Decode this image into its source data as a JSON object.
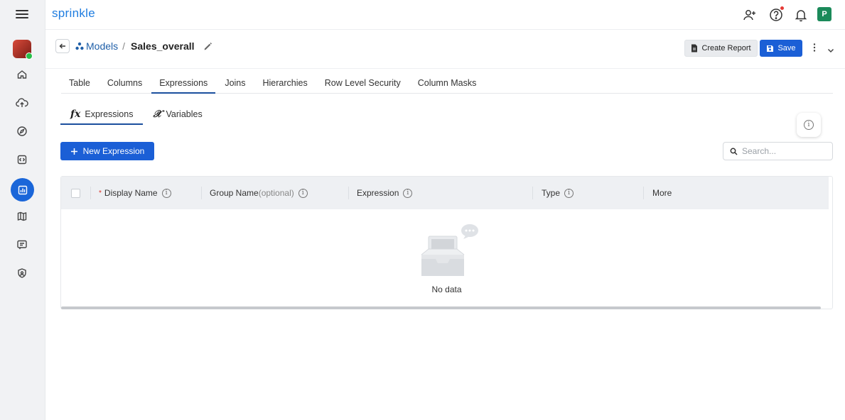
{
  "app": {
    "brand": "sprinkle"
  },
  "header": {
    "avatar_initial": "P"
  },
  "breadcrumb": {
    "parent": "Models",
    "separator": "/",
    "current": "Sales_overall"
  },
  "actions": {
    "create_report": "Create Report",
    "save": "Save"
  },
  "tabs": [
    {
      "label": "Table",
      "active": false
    },
    {
      "label": "Columns",
      "active": false
    },
    {
      "label": "Expressions",
      "active": true
    },
    {
      "label": "Joins",
      "active": false
    },
    {
      "label": "Hierarchies",
      "active": false
    },
    {
      "label": "Row Level Security",
      "active": false
    },
    {
      "label": "Column Masks",
      "active": false
    }
  ],
  "subtabs": [
    {
      "icon": "fx-icon",
      "label": "Expressions",
      "active": true
    },
    {
      "icon": "x-variable-icon",
      "label": "Variables",
      "active": false
    }
  ],
  "toolbar": {
    "new_button": "New Expression",
    "search_placeholder": "Search..."
  },
  "table": {
    "columns": [
      {
        "label": "Display Name",
        "required": true,
        "optional_suffix": ""
      },
      {
        "label": "Group Name",
        "required": false,
        "optional_suffix": "(optional)"
      },
      {
        "label": "Expression",
        "required": false,
        "optional_suffix": ""
      },
      {
        "label": "Type",
        "required": false,
        "optional_suffix": ""
      },
      {
        "label": "More",
        "required": false,
        "optional_suffix": ""
      }
    ],
    "rows": [],
    "empty_text": "No data"
  },
  "theme": {
    "accent": "#1b5fd6",
    "brand": "#1f7de0",
    "active_nav": "#1a66d9"
  }
}
